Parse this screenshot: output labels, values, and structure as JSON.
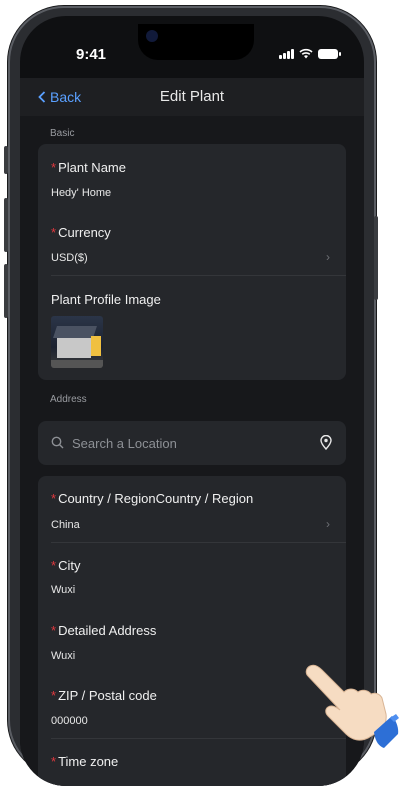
{
  "status": {
    "time": "9:41"
  },
  "nav": {
    "back_label": "Back",
    "title": "Edit Plant"
  },
  "basic": {
    "section_label": "Basic",
    "plant_name": {
      "label": "Plant Name",
      "value": "Hedy' Home"
    },
    "currency": {
      "label": "Currency",
      "value": "USD($)"
    },
    "profile_image": {
      "label": "Plant Profile Image"
    }
  },
  "address": {
    "section_label": "Address",
    "search": {
      "placeholder": "Search a Location"
    },
    "country": {
      "label": "Country / Region",
      "label_hint": "Country / Region",
      "value": "China"
    },
    "city": {
      "label": "City",
      "value": "Wuxi"
    },
    "detailed_address": {
      "label": "Detailed Address",
      "value": "Wuxi"
    },
    "zip": {
      "label": "ZIP / Postal code",
      "value": "000000"
    },
    "time_zone": {
      "label": "Time zone"
    }
  },
  "colors": {
    "accent": "#5aa0ff",
    "required": "#e0383e",
    "card": "#25272b",
    "background": "#17181b"
  },
  "icons": [
    "chevron-left-icon",
    "chevron-right-icon",
    "search-icon",
    "location-pin-icon",
    "signal-icon",
    "wifi-icon",
    "battery-icon",
    "pointing-hand-icon"
  ]
}
